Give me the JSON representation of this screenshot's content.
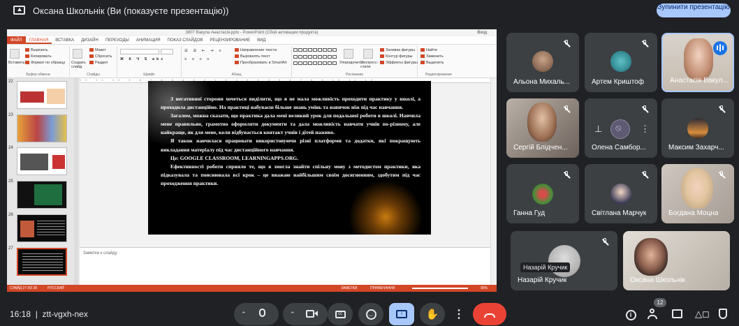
{
  "header": {
    "presenter_title": "Оксана Школьнік (Ви (показуєте презентацію))",
    "stop_button": "Зупинити презентацію"
  },
  "powerpoint": {
    "window_title": "3807 Вакула Анастасія.pptx - PowerPoint (Сбой активации продукта)",
    "login_label": "Вход",
    "tabs": [
      "ФАЙЛ",
      "ГЛАВНАЯ",
      "ВСТАВКА",
      "ДИЗАЙН",
      "ПЕРЕХОДЫ",
      "АНИМАЦИЯ",
      "ПОКАЗ СЛАЙДОВ",
      "РЕЦЕНЗИРОВАНИЕ",
      "ВИД"
    ],
    "ribbon": {
      "paste": "Вставить",
      "cut": "Вырезать",
      "copy": "Копировать",
      "format_painter": "Формат по образцу",
      "clipboard": "Буфер обмена",
      "new_slide": "Создать слайд",
      "layout": "Макет",
      "reset": "Сбросить",
      "section": "Раздел",
      "slides": "Слайды",
      "font": "Шрифт",
      "text_direction": "Направление текста",
      "align_text": "Выровнять текст",
      "smartart": "Преобразовать в SmartArt",
      "paragraph": "Абзац",
      "arrange": "Упорядочить",
      "quick_styles": "Экспресс-стили",
      "drawing": "Рисование",
      "shape_fill": "Заливка фигуры",
      "shape_outline": "Контур фигуры",
      "shape_effects": "Эффекты фигуры",
      "find": "Найти",
      "replace": "Заменить",
      "select": "Выделить",
      "editing": "Редактирование"
    },
    "thumbnails": [
      "22",
      "23",
      "24",
      "25",
      "26",
      "27"
    ],
    "slide_paragraphs": [
      "З негативної сторони хочеться виділити, що я не мала можливість проходити практику у школі, а проходила дистанційно. На практиці набуваєш більше знань умінь та навичок ніж під час навчання.",
      "Загалом, можна сказати, що практика дала мені великий урок для подальшої роботи в школі. Навчила мене правильно, грамотно оформляти документи та дала можливість навчати учнів по-різному, але найкраще, як для мене, коли відбувається контакт учнів і дітей наживо.",
      "Я також навчилася працювати використовуючи різні платформи та додатки, які покращують викладання матеріалу під час дистанційного навчання.",
      "Це: GOOGLE CLASSROOM, LEARNINGAPPS.ORG.",
      "Ефективності роботи сприяло те, що я змогла знайти спільну мову з методистом практики, яка підказувала та пояснювала всі крок – це вважаю найбільшим своїм досягненням, здобутим під час проходження практики."
    ],
    "notes_placeholder": "Заметки к слайду",
    "status": {
      "slide": "СЛАЙД 27 ИЗ 28",
      "language": "РУССКИЙ",
      "notes": "ЗАМЕТКИ",
      "comments": "ПРИМЕЧАНИЯ",
      "zoom": "95%"
    }
  },
  "participants": [
    {
      "name": "Альона Михаль..."
    },
    {
      "name": "Артем Криштоф"
    },
    {
      "name": "Анастасія Вакул..."
    },
    {
      "name": "Сергій Блідчен..."
    },
    {
      "name": "Олена Самбор..."
    },
    {
      "name": "Максим Захарч..."
    },
    {
      "name": "Ганна Гуд"
    },
    {
      "name": "Світлана Марчук"
    },
    {
      "name": "Богдана Моцна"
    },
    {
      "name": "Назарій Кручик",
      "tooltip": "Назарій Кручик"
    },
    {
      "name": "Оксана Школьнік"
    }
  ],
  "footer": {
    "time": "16:18",
    "meeting_code": "ztt-vgxh-nex",
    "participant_count": "12"
  },
  "icons": [
    "present-to-all-icon",
    "mic-icon",
    "camera-icon",
    "captions-icon",
    "emoji-icon",
    "present-icon",
    "hand-icon",
    "more-icon",
    "end-call-icon",
    "info-icon",
    "people-icon",
    "chat-icon",
    "activities-icon",
    "pin-icon",
    "mic-off-icon"
  ],
  "colors": {
    "accent": "#a8c7fa",
    "end_call": "#ea4335",
    "ppt": "#d24726",
    "bg": "#202124",
    "tile": "#3c4043"
  }
}
